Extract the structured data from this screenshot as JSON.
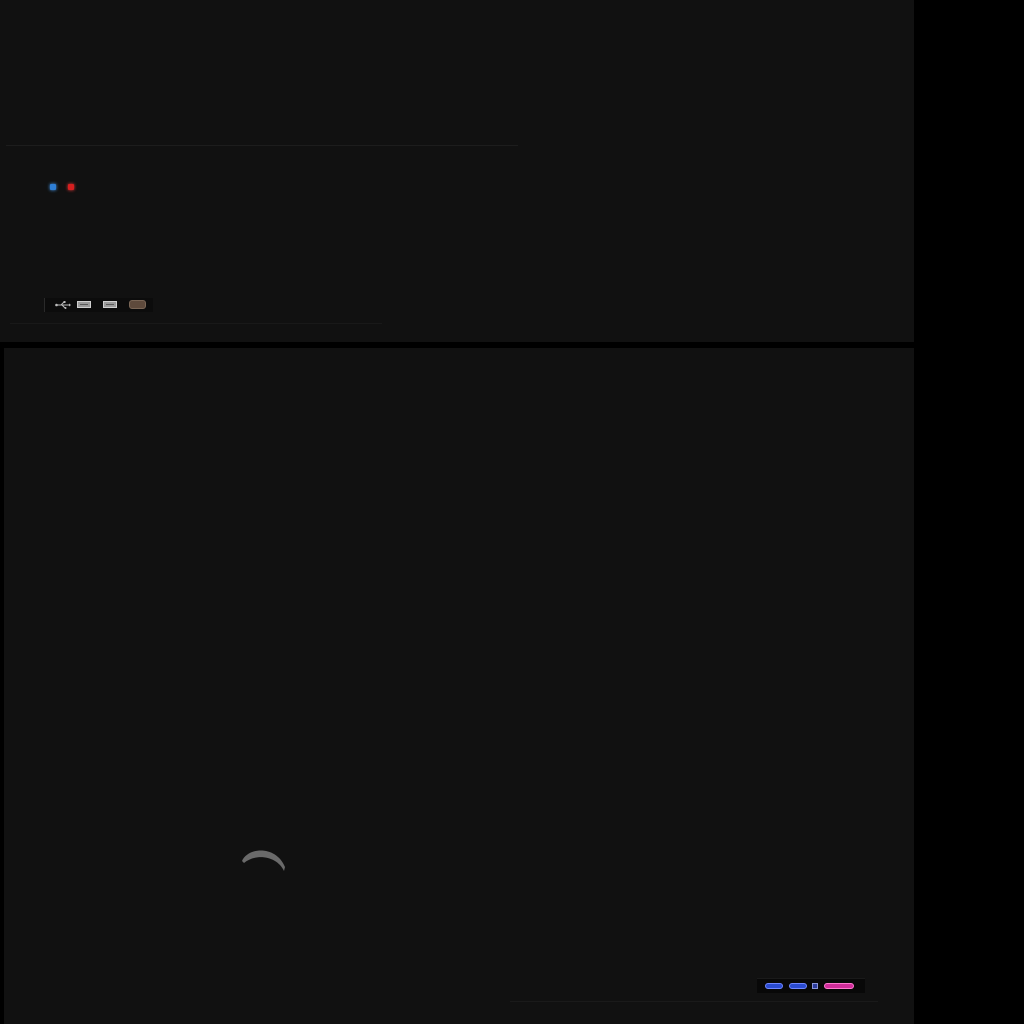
{
  "screen": {
    "background_color": "#000000",
    "panel_color": "#111111"
  },
  "top_panel": {
    "status_leds": [
      {
        "name": "power-led",
        "color": "#2e7fd6"
      },
      {
        "name": "activity-led",
        "color": "#d61f1f"
      }
    ],
    "front_ports": [
      {
        "icon": "usb-symbol-icon"
      },
      {
        "icon": "usb-port-icon"
      },
      {
        "icon": "usb-port-icon"
      },
      {
        "icon": "audio-jack-icon"
      }
    ]
  },
  "bottom_panel": {
    "loading": {
      "icon": "loading-spinner-icon",
      "color": "#6a6a6a"
    },
    "rear_ports": [
      {
        "icon": "vga-port-icon",
        "color": "#2a4bd0"
      },
      {
        "icon": "vga-port-icon",
        "color": "#2a4bd0"
      },
      {
        "icon": "small-port-icon",
        "color": "#2c3b9a"
      },
      {
        "icon": "parallel-port-icon",
        "color": "#d12c9a"
      }
    ]
  }
}
